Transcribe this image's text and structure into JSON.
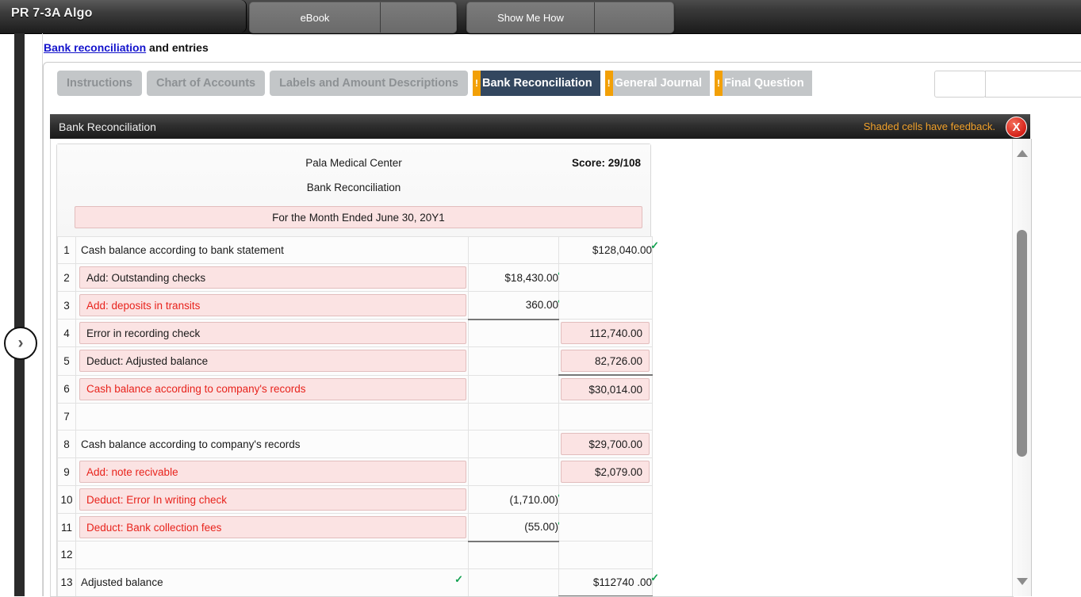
{
  "topbar": {
    "title": "PR 7-3A Algo",
    "buttons": [
      {
        "id": "ebook",
        "label": "eBook"
      },
      {
        "id": "showmehow",
        "label": "Show Me How"
      }
    ]
  },
  "breadcrumb": {
    "link": "Bank reconciliation",
    "rest": " and entries"
  },
  "tabs": [
    {
      "label": "Instructions",
      "state": "inactive",
      "flag": false
    },
    {
      "label": "Chart of Accounts",
      "state": "inactive",
      "flag": false
    },
    {
      "label": "Labels and Amount Descriptions",
      "state": "inactive",
      "flag": false
    },
    {
      "label": "Bank Reconciliation",
      "state": "active",
      "flag": true,
      "flag_glyph": "!"
    },
    {
      "label": "General Journal",
      "state": "pending",
      "flag": true,
      "flag_glyph": "!"
    },
    {
      "label": "Final Question",
      "state": "pending",
      "flag": true,
      "flag_glyph": "!"
    }
  ],
  "panel": {
    "title": "Bank Reconciliation",
    "feedback_note": "Shaded cells have feedback.",
    "close_glyph": "X"
  },
  "sheet": {
    "company": "Pala Medical Center",
    "report_name": "Bank Reconciliation",
    "period": "For the Month Ended June 30, 20Y1",
    "score_label": "Score: 29/108"
  },
  "colors": {
    "accent_orange": "#f2a007",
    "active_tab": "#33475f",
    "shaded_cell": "#fbe3e3",
    "shaded_border": "#e2bdbd",
    "error_text": "#e8231c",
    "check_green": "#12a150",
    "link_blue": "#1414cc"
  },
  "rows": [
    {
      "n": "1",
      "desc": "Cash balance according to bank statement",
      "desc_style": "plain",
      "indent": 0,
      "desc_check": false,
      "c1": "",
      "c1_check": false,
      "c1_shaded": false,
      "c2": "$128,040.00",
      "c2_check": true,
      "c2_shaded": false
    },
    {
      "n": "2",
      "desc": "Add: Outstanding checks",
      "desc_style": "shaded",
      "indent": 1,
      "desc_check": false,
      "c1": "$18,430.00",
      "c1_check": true,
      "c1_shaded": false,
      "c2": "",
      "c2_check": false,
      "c2_shaded": false
    },
    {
      "n": "3",
      "desc": "Add: deposits in transits",
      "desc_style": "shaded-red",
      "indent": 1,
      "desc_check": false,
      "c1": "360.00",
      "c1_check": true,
      "c1_shaded": false,
      "c2": "",
      "c2_check": false,
      "c2_shaded": false
    },
    {
      "n": "4",
      "desc": "Error in recording check",
      "desc_style": "shaded",
      "indent": 2,
      "desc_check": false,
      "c1": "",
      "c1_check": false,
      "c1_shaded": false,
      "c1_topline": true,
      "c2": "112,740.00",
      "c2_check": false,
      "c2_shaded": true
    },
    {
      "n": "5",
      "desc": "Deduct: Adjusted balance",
      "desc_style": "shaded",
      "indent": 1,
      "desc_check": false,
      "c1": "",
      "c1_check": false,
      "c1_shaded": false,
      "c2": "82,726.00",
      "c2_check": false,
      "c2_shaded": true
    },
    {
      "n": "6",
      "desc": "Cash balance according to company's records",
      "desc_style": "shaded-red",
      "indent": 0,
      "desc_check": false,
      "c1": "",
      "c1_check": false,
      "c1_shaded": false,
      "c2": "$30,014.00",
      "c2_check": false,
      "c2_shaded": true,
      "c2_topline": true
    },
    {
      "n": "7",
      "desc": "",
      "desc_style": "plain",
      "indent": 0,
      "desc_check": false,
      "c1": "",
      "c1_check": false,
      "c1_shaded": false,
      "c2": "",
      "c2_check": false,
      "c2_shaded": false
    },
    {
      "n": "8",
      "desc": "Cash balance according to company's records",
      "desc_style": "plain",
      "indent": 0,
      "desc_check": false,
      "c1": "",
      "c1_check": false,
      "c1_shaded": false,
      "c2": "$29,700.00",
      "c2_check": false,
      "c2_shaded": true
    },
    {
      "n": "9",
      "desc": "Add: note recivable",
      "desc_style": "shaded-red",
      "indent": 1,
      "desc_check": false,
      "c1": "",
      "c1_check": false,
      "c1_shaded": false,
      "c2": "$2,079.00",
      "c2_check": false,
      "c2_shaded": true
    },
    {
      "n": "10",
      "desc": "Deduct: Error In writing check",
      "desc_style": "shaded-red",
      "indent": 1,
      "desc_check": false,
      "c1": "(1,710.00)",
      "c1_check": true,
      "c1_shaded": false,
      "c2": "",
      "c2_check": false,
      "c2_shaded": false
    },
    {
      "n": "11",
      "desc": "Deduct: Bank collection fees",
      "desc_style": "shaded-red",
      "indent": 1,
      "desc_check": false,
      "c1": "(55.00)",
      "c1_check": true,
      "c1_shaded": false,
      "c2": "",
      "c2_check": false,
      "c2_shaded": false
    },
    {
      "n": "12",
      "desc": "",
      "desc_style": "plain",
      "indent": 0,
      "desc_check": false,
      "c1": "",
      "c1_check": false,
      "c1_shaded": false,
      "c1_topline": true,
      "c2": "",
      "c2_check": false,
      "c2_shaded": false
    },
    {
      "n": "13",
      "desc": "Adjusted balance",
      "desc_style": "plain",
      "indent": 0,
      "desc_check": true,
      "c1": "",
      "c1_check": false,
      "c1_shaded": false,
      "c2": "$112740 .00",
      "c2_check": true,
      "c2_shaded": false,
      "c2_dblline": true
    }
  ],
  "scrollbar": {
    "up_glyph": "▲",
    "down_glyph": "▼"
  },
  "expand_button": {
    "glyph": "›"
  }
}
